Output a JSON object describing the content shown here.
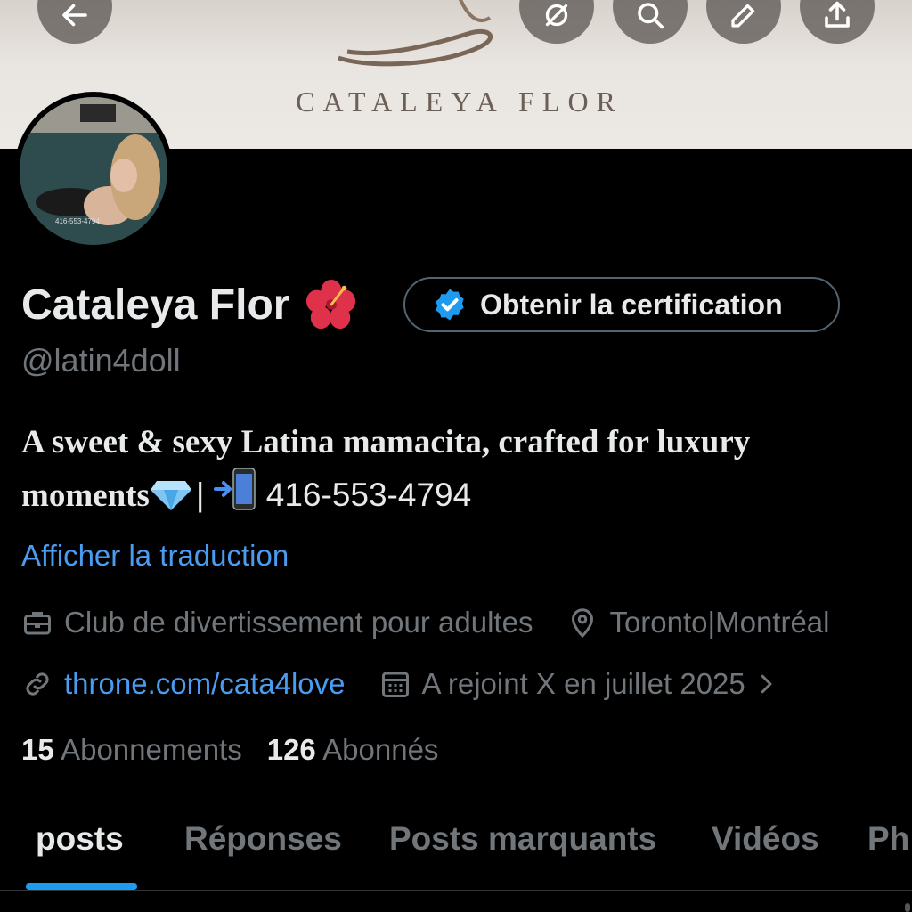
{
  "banner": {
    "brand_name": "CATALEYA FLOR"
  },
  "header_buttons": [
    {
      "icon": "back-arrow-icon"
    },
    {
      "icon": "grok-icon"
    },
    {
      "icon": "search-icon"
    },
    {
      "icon": "edit-icon"
    },
    {
      "icon": "share-icon"
    }
  ],
  "profile": {
    "display_name": "Cataleya Flor",
    "name_emoji": "hibiscus",
    "handle": "@latin4doll",
    "avatar_watermark": "416-553-4794",
    "verify_button": "Obtenir la certification",
    "bio_line1": "A sweet & sexy Latina mamacita, crafted for luxury",
    "bio_line2_text": "moments",
    "bio_separator": "|",
    "bio_phone": "416-553-4794",
    "translate_link": "Afficher la traduction",
    "category": "Club de divertissement pour adultes",
    "location": "Toronto|Montréal",
    "website": "throne.com/cata4love",
    "joined": "A rejoint X en juillet 2025",
    "following_count": "15",
    "following_label": "Abonnements",
    "followers_count": "126",
    "followers_label": "Abonnés"
  },
  "tabs": [
    "posts",
    "Réponses",
    "Posts marquants",
    "Vidéos",
    "Ph"
  ],
  "colors": {
    "accent": "#1d9bf0",
    "link": "#4a9cf0",
    "muted": "#71767b",
    "background": "#000000"
  }
}
